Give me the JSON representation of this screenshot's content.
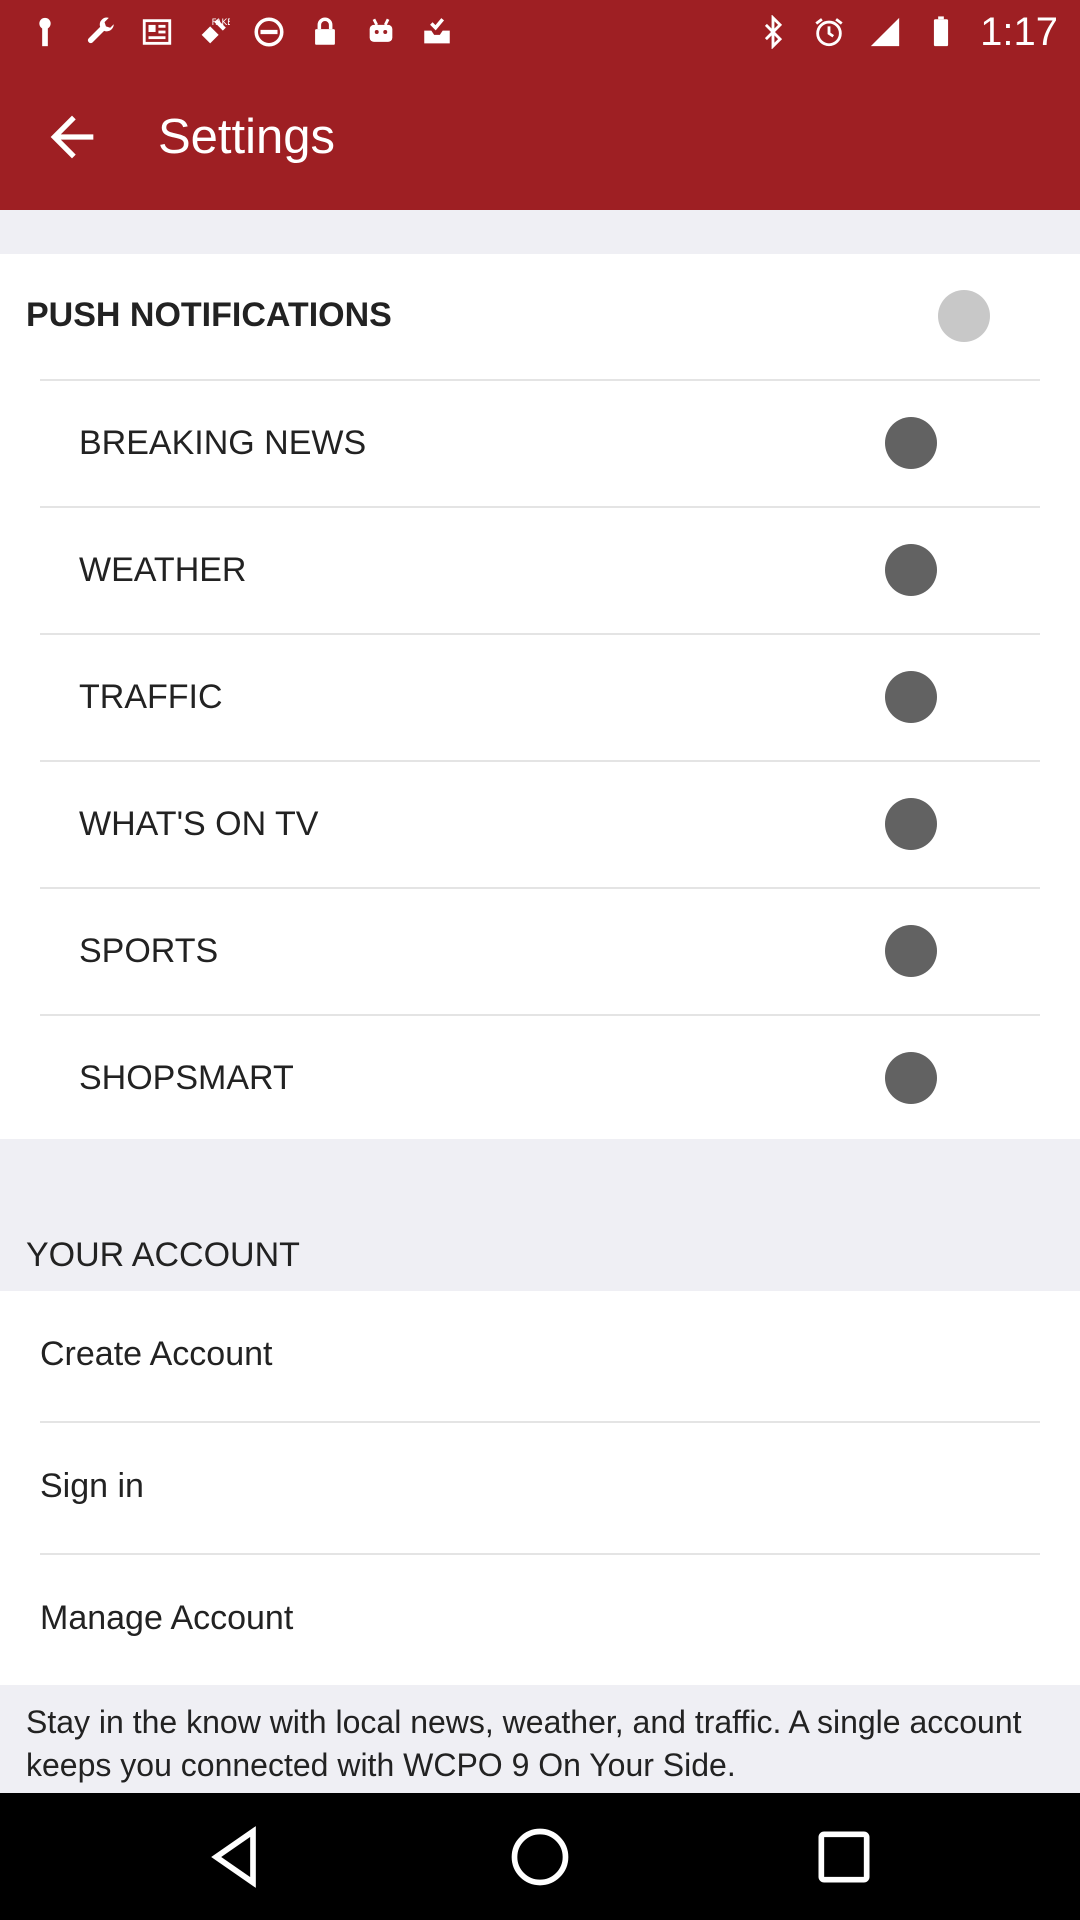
{
  "status_bar": {
    "time": "1:17",
    "left_icons": [
      "notification-icon",
      "wrench-icon",
      "news-icon",
      "fake-gps-icon",
      "blocked-icon",
      "lock-icon",
      "android-icon",
      "inbox-check-icon"
    ],
    "right_icons": [
      "bluetooth-icon",
      "alarm-icon",
      "signal-icon",
      "battery-icon"
    ]
  },
  "app_bar": {
    "title": "Settings",
    "background": "#9e1f23"
  },
  "push_notifications": {
    "label": "PUSH NOTIFICATIONS",
    "items": [
      {
        "label": "BREAKING NEWS"
      },
      {
        "label": "WEATHER"
      },
      {
        "label": "TRAFFIC"
      },
      {
        "label": "WHAT'S ON TV"
      },
      {
        "label": "SPORTS"
      },
      {
        "label": "SHOPSMART"
      }
    ]
  },
  "account": {
    "section_title": "YOUR ACCOUNT",
    "items": [
      {
        "label": "Create Account"
      },
      {
        "label": "Sign in"
      },
      {
        "label": "Manage Account"
      }
    ],
    "footer_text": "Stay in the know with local news, weather, and traffic. A single account keeps you connected with WCPO 9 On Your Side."
  },
  "nav_bar": {
    "icons": [
      "back-triangle-icon",
      "home-circle-icon",
      "recents-square-icon"
    ]
  }
}
